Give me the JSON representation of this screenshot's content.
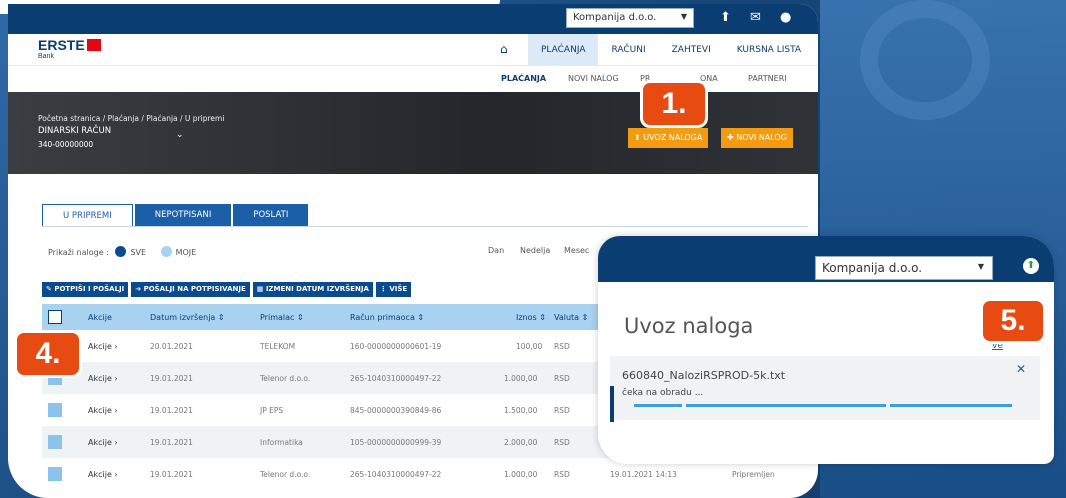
{
  "topbar": {
    "company": "Kompanija d.o.o."
  },
  "logo": {
    "name": "ERSTE",
    "sub": "Bank"
  },
  "main_nav": [
    "PLAĆANJA",
    "RAČUNI",
    "ZAHTEVI",
    "KURSNA LISTA"
  ],
  "sub_nav": [
    "PLAĆANJA",
    "NOVI NALOG",
    "PR",
    "ONA",
    "PARTNERI"
  ],
  "hero": {
    "breadcrumb": "Početna stranica / Plaćanja / Plaćanja / U pripremi",
    "account_name": "DINARSKI RAČUN",
    "account_number": "340-00000000",
    "btn_import": "UVOZ NALOGA",
    "btn_new": "NOVI NALOG"
  },
  "tabs": [
    "U PRIPREMI",
    "NEPOTPISANI",
    "POSLATI"
  ],
  "filter": {
    "label": "Prikaži naloge :",
    "all": "SVE",
    "mine": "MOJE"
  },
  "period": [
    "Dan",
    "Nedelja",
    "Mesec"
  ],
  "actions": [
    "POTPIŠI I POŠALJI",
    "POŠALJI NA POTPISIVANJE",
    "IZMENI DATUM IZVRŠENJA",
    "VIŠE"
  ],
  "table": {
    "headers": [
      "Akcije",
      "Datum izvršenja ⇕",
      "Primalac ⇕",
      "Račun primaoca ⇕",
      "Iznos ⇕",
      "Valuta ⇕"
    ],
    "rows": [
      {
        "action": "Akcije ›",
        "date": "20.01.2021",
        "recipient": "TELEKOM",
        "account": "160-0000000000601-19",
        "amount": "100,00",
        "currency": "RSD",
        "created": "",
        "status": ""
      },
      {
        "action": "Akcije ›",
        "date": "19.01.2021",
        "recipient": "Telenor d.o.o.",
        "account": "265-1040310000497-22",
        "amount": "1.000,00",
        "currency": "RSD",
        "created": "",
        "status": ""
      },
      {
        "action": "Akcije ›",
        "date": "19.01.2021",
        "recipient": "JP EPS",
        "account": "845-0000000390849-86",
        "amount": "1.500,00",
        "currency": "RSD",
        "created": "",
        "status": ""
      },
      {
        "action": "Akcije ›",
        "date": "19.01.2021",
        "recipient": "Informatika",
        "account": "105-0000000000999-39",
        "amount": "2.000,00",
        "currency": "RSD",
        "created": "",
        "status": ""
      },
      {
        "action": "Akcije ›",
        "date": "19.01.2021",
        "recipient": "Telenor d.o.o.",
        "account": "265-1040310000497-22",
        "amount": "1.000,00",
        "currency": "RSD",
        "created": "19.01.2021 14:13",
        "status": "Pripremljen"
      }
    ]
  },
  "modal": {
    "company": "Kompanija d.o.o.",
    "title": "Uvoz naloga",
    "close_link": "ve",
    "file_name": "660840_NaloziRSPROD-5k.txt",
    "file_status": "čeka na obradu ..."
  },
  "callouts": [
    "1.",
    "4.",
    "5."
  ],
  "colors": {
    "brand": "#0a3e73",
    "accent": "#f39c12",
    "callout": "#e84b12",
    "header_row": "#a9d2f0"
  }
}
